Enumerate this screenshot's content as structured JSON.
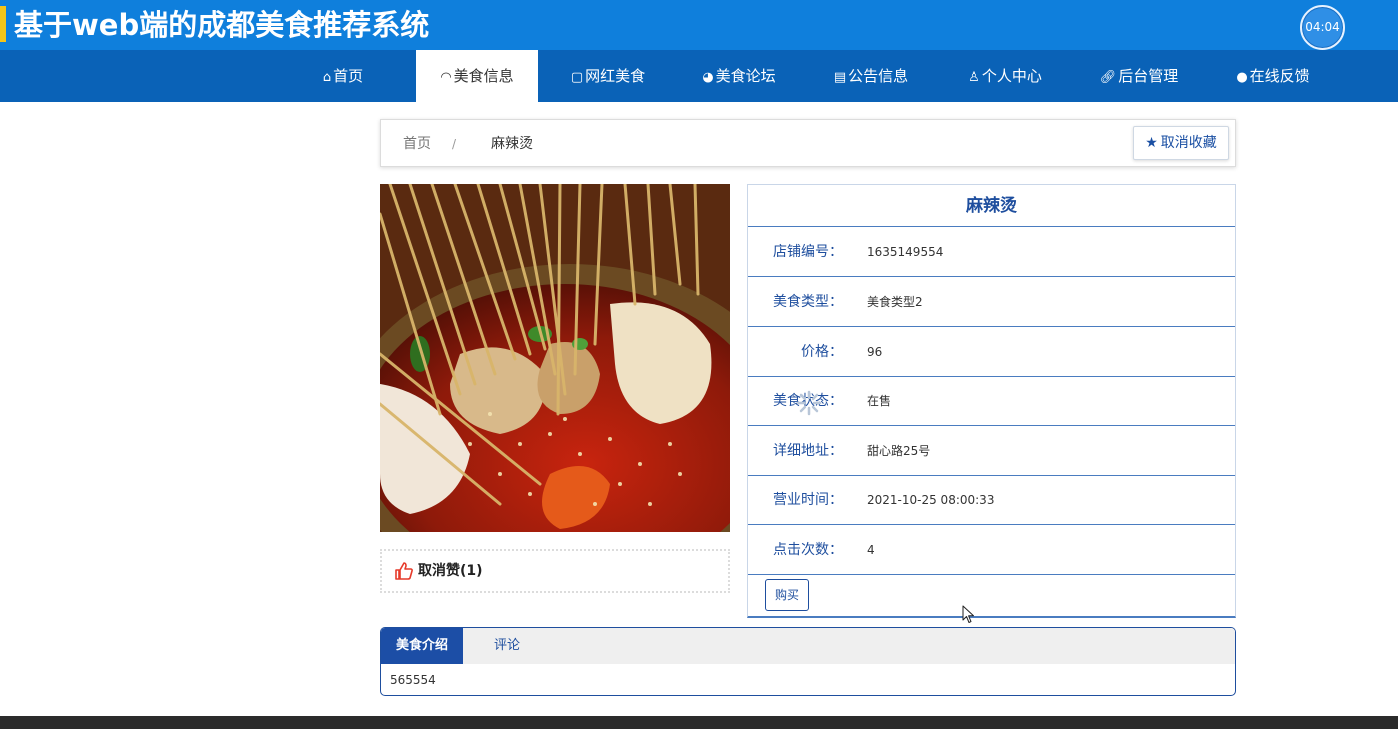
{
  "header": {
    "title": "基于web端的成都美食推荐系统",
    "clock": "04:04",
    "accent_color": "#f5c518",
    "background_color": "#0f7fdc"
  },
  "nav": {
    "items": [
      {
        "label": "首页",
        "icon": "home-icon"
      },
      {
        "label": "美食信息",
        "icon": "gauge-icon",
        "active": true
      },
      {
        "label": "网红美食",
        "icon": "edit-icon"
      },
      {
        "label": "美食论坛",
        "icon": "palette-icon"
      },
      {
        "label": "公告信息",
        "icon": "list-icon"
      },
      {
        "label": "个人中心",
        "icon": "user-icon"
      },
      {
        "label": "后台管理",
        "icon": "link-icon"
      },
      {
        "label": "在线反馈",
        "icon": "chat-icon"
      }
    ]
  },
  "breadcrumb": {
    "home": "首页",
    "separator": "/",
    "current": "麻辣烫"
  },
  "favorite_button": {
    "label": "取消收藏",
    "icon": "star-icon"
  },
  "like": {
    "label": "取消赞(1)",
    "icon": "thumbs-up-icon"
  },
  "food": {
    "name": "麻辣烫",
    "fields": [
      {
        "label": "店铺编号：",
        "value": "1635149554"
      },
      {
        "label": "美食类型：",
        "value": "美食类型2"
      },
      {
        "label": "价格：",
        "value": "96"
      },
      {
        "label": "美食状态：",
        "value": "在售"
      },
      {
        "label": "详细地址：",
        "value": "甜心路25号"
      },
      {
        "label": "营业时间：",
        "value": "2021-10-25 08:00:33"
      },
      {
        "label": "点击次数：",
        "value": "4"
      }
    ],
    "buy_label": "购买"
  },
  "tabs": {
    "items": [
      "美食介绍",
      "评论"
    ],
    "active_content": "565554"
  }
}
